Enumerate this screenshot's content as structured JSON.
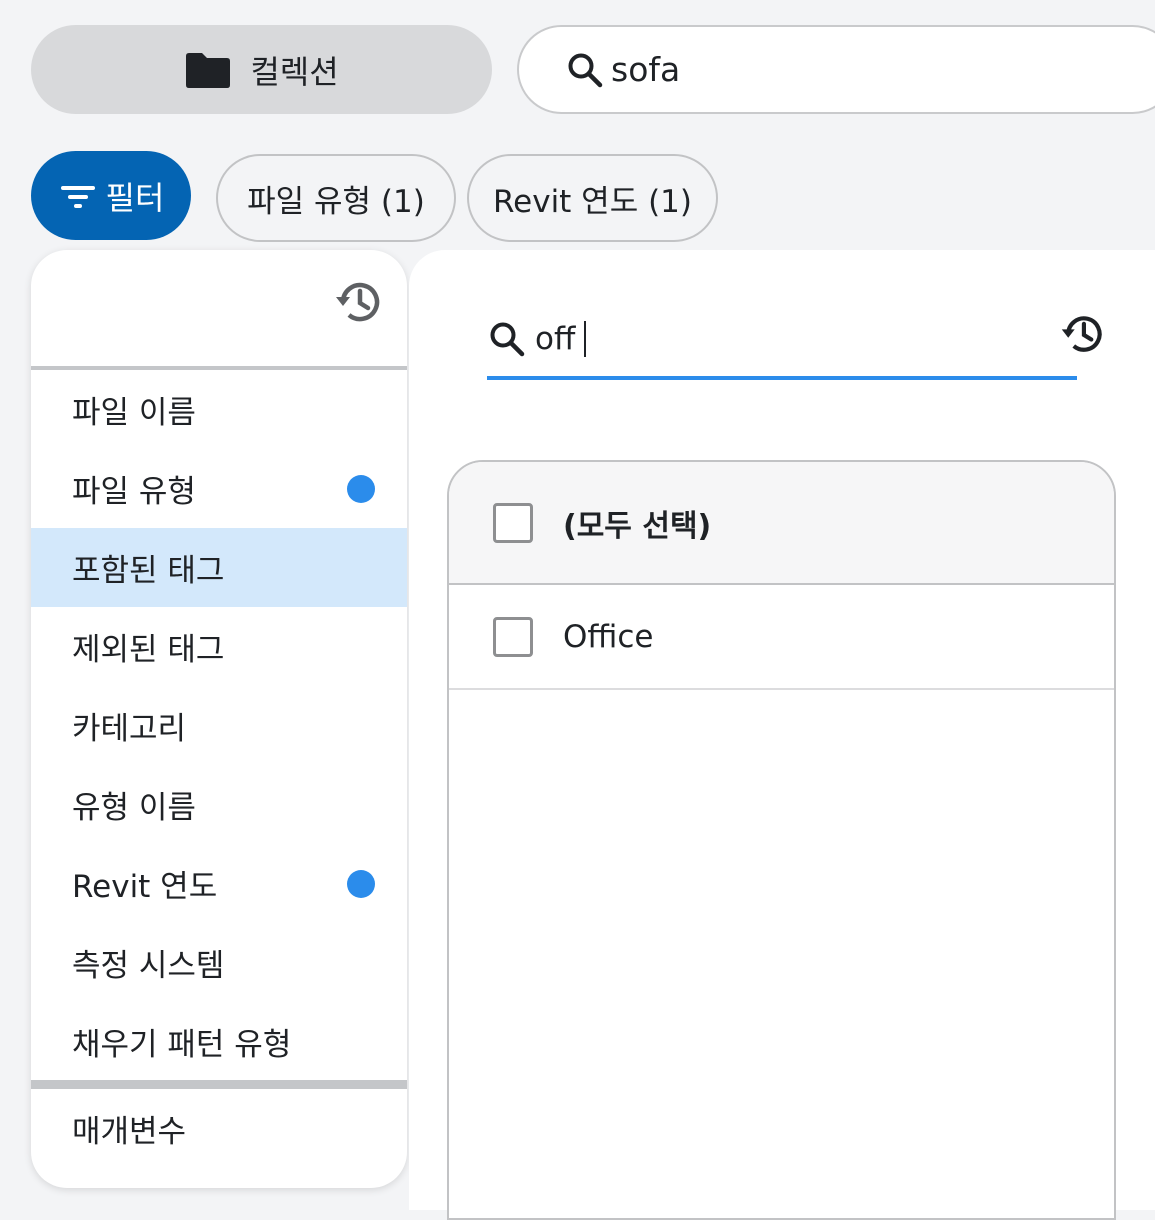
{
  "toolbar": {
    "collections_label": "컬렉션",
    "search_value": "sofa"
  },
  "filters": {
    "filter_label": "필터",
    "chips": [
      {
        "label": "파일 유형 (1)"
      },
      {
        "label": "Revit 연도 (1)"
      }
    ]
  },
  "left_panel": {
    "items": [
      {
        "label": "파일 이름",
        "active": false,
        "selected": false
      },
      {
        "label": "파일 유형",
        "active": true,
        "selected": false
      },
      {
        "label": "포함된 태그",
        "active": false,
        "selected": true
      },
      {
        "label": "제외된 태그",
        "active": false,
        "selected": false
      },
      {
        "label": "카테고리",
        "active": false,
        "selected": false
      },
      {
        "label": "유형 이름",
        "active": false,
        "selected": false
      },
      {
        "label": "Revit 연도",
        "active": true,
        "selected": false
      },
      {
        "label": "측정 시스템",
        "active": false,
        "selected": false
      },
      {
        "label": "채우기 패턴 유형",
        "active": false,
        "selected": false
      }
    ],
    "params_label": "매개변수"
  },
  "right_panel": {
    "search_value": "off",
    "select_all_label": "(모두 선택)",
    "rows": [
      {
        "label": "Office",
        "checked": false
      }
    ]
  },
  "colors": {
    "accent": "#0464b3",
    "active_dot": "#2b8ceb",
    "selected_row": "#d3e8fb"
  }
}
